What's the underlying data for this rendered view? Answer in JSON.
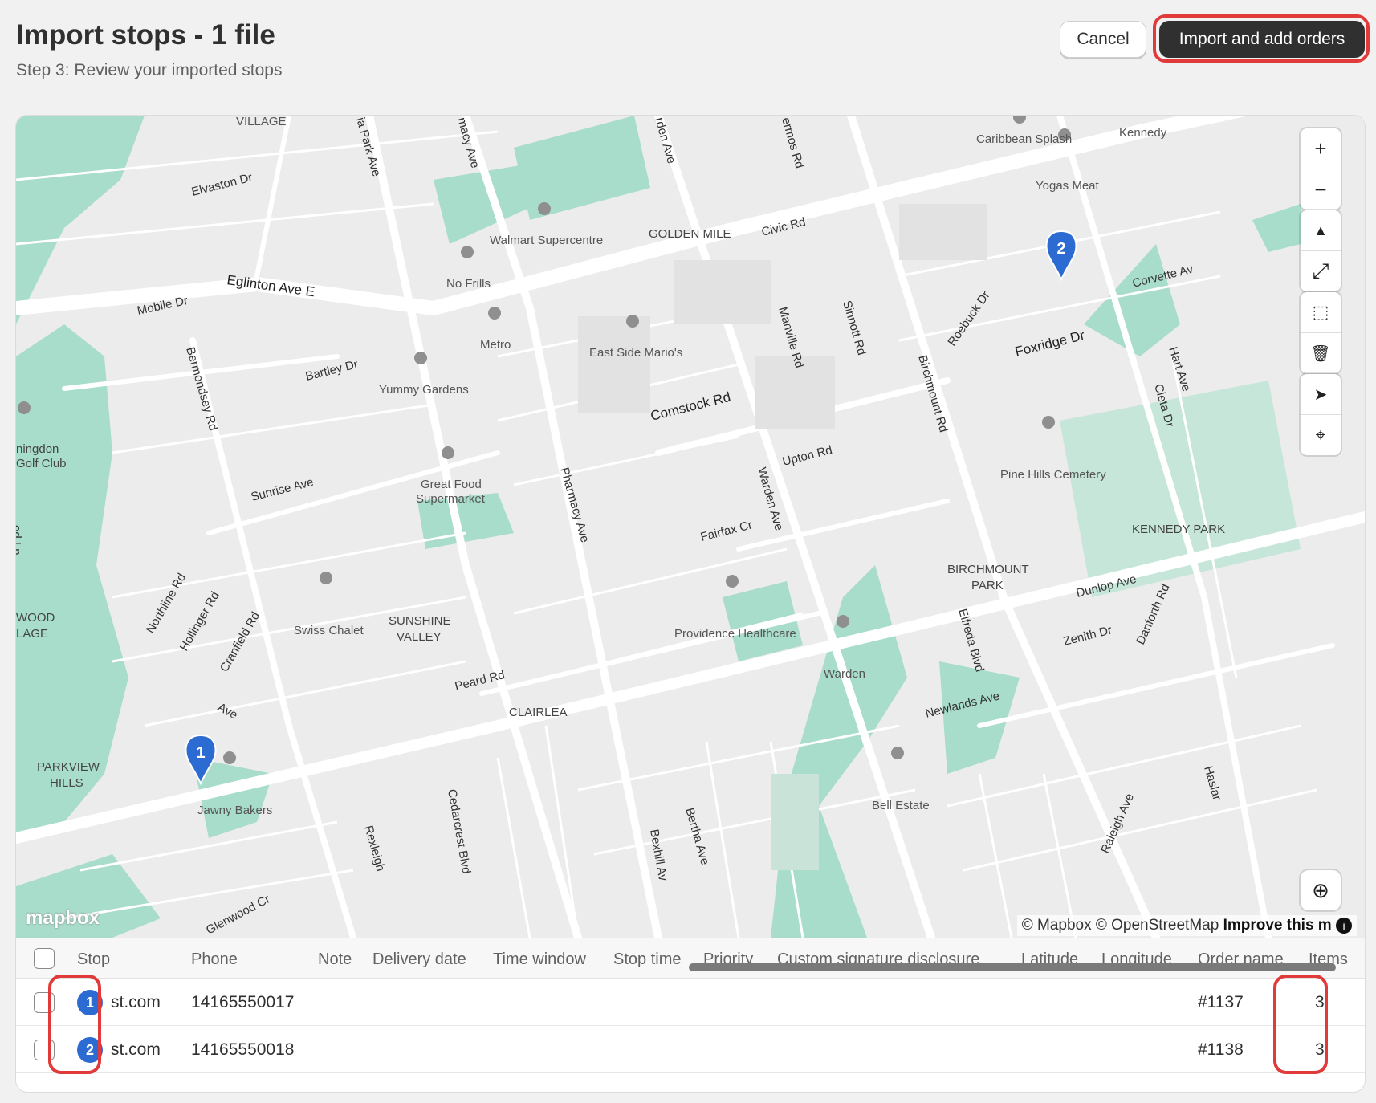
{
  "header": {
    "title": "Import stops - 1 file",
    "subtitle": "Step 3: Review your imported stops",
    "cancel_label": "Cancel",
    "primary_label": "Import and add orders"
  },
  "map": {
    "labels": {
      "village": "VILLAGE",
      "caribbean": "Caribbean Splash",
      "kennedy": "Kennedy",
      "elvaston": "Elvaston Dr",
      "yogas": "Yogas Meat",
      "walmart": "Walmart Supercentre",
      "golden_mile": "GOLDEN MILE",
      "civic": "Civic Rd",
      "eglinton": "Eglinton Ave E",
      "nofrills": "No Frills",
      "mobile": "Mobile Dr",
      "corvette": "Corvette Av",
      "metro": "Metro",
      "eastside": "East Side Mario's",
      "bartley": "Bartley Dr",
      "yummy": "Yummy Gardens",
      "roebuck": "Roebuck Dr",
      "foxridge": "Foxridge Dr",
      "hart": "Hart Ave",
      "comstock": "Comstock Rd",
      "bermondsey": "Bermondsey Rd",
      "manville": "Manville Rd",
      "sinnott": "Sinnott Rd",
      "birchmount_rd": "Birchmount Rd",
      "cleta": "Cleta Dr",
      "golf_club": "ningdon\nGolf Club",
      "upton": "Upton Rd",
      "great_food": "Great Food",
      "supermarket": "Supermarket",
      "sunrise": "Sunrise Ave",
      "pharmacy": "Pharmacy Ave",
      "pine_hills": "Pine Hills Cemetery",
      "fairfax": "Fairfax Cr",
      "warden_ave": "Warden Ave",
      "kennedy_park": "KENNEDY PARK",
      "birchmount_park_1": "BIRCHMOUNT",
      "birchmount_park_2": "PARK",
      "dunlop": "Dunlop Ave",
      "northline": "Northline Rd",
      "hollinger": "Hollinger Rd",
      "cranfield": "Cranfield Rd",
      "swiss": "Swiss Chalet",
      "sunshine_1": "SUNSHINE",
      "sunshine_2": "VALLEY",
      "providence": "Providence Healthcare",
      "elfreda": "Elfreda Blvd",
      "zenith": "Zenith Dr",
      "danforth": "Danforth Rd",
      "wood": "WOOD",
      "lage": "LAGE",
      "warden": "Warden",
      "peard": "Peard Rd",
      "clairlea": "CLAIRLEA",
      "newlands": "Newlands Ave",
      "ave_near_1": "Ave",
      "parkview_1": "PARKVIEW",
      "parkview_2": "HILLS",
      "bell": "Bell Estate",
      "jawny": "Jawny Bakers",
      "cedarcrest": "Cedarcrest Blvd",
      "bexhill": "Bexhill Av",
      "bertha": "Bertha Ave",
      "raleigh": "Raleigh Ave",
      "haslar": "Haslar",
      "glenwood": "Glenwood Cr",
      "rexleigh": "Rexleigh",
      "ia_park": "ia Park Ave",
      "macy": "macy Ave",
      "rden": "rden Ave",
      "ermos": "ermos Rd",
      "dd_ln": "od Ln"
    },
    "pins": [
      {
        "number": "1"
      },
      {
        "number": "2"
      }
    ],
    "controls": {
      "zoom_in": "+",
      "zoom_out": "−",
      "compass": "▲",
      "fullscreen": "⤢",
      "select_area": "⬚",
      "delete": "🗑",
      "pointer": "➤",
      "lasso": "⌖",
      "globe": "⊕"
    },
    "mapbox_logo": "mapbox",
    "attribution": "© Mapbox © OpenStreetMap",
    "improve": "Improve this m"
  },
  "table": {
    "columns": [
      "Stop",
      "Phone",
      "Note",
      "Delivery date",
      "Time window",
      "Stop time",
      "Priority",
      "Custom signature disclosure",
      "Latitude",
      "Longitude",
      "Order name",
      "Items"
    ],
    "rows": [
      {
        "stop": "1",
        "email": "st.com",
        "phone": "14165550017",
        "order": "#1137",
        "items": "3"
      },
      {
        "stop": "2",
        "email": "st.com",
        "phone": "14165550018",
        "order": "#1138",
        "items": "3"
      }
    ]
  },
  "colors": {
    "accent": "#2c6bd1",
    "highlight": "#e03a3a",
    "park": "#a8dccb",
    "road": "#ffffff",
    "primary_button": "#303030"
  }
}
